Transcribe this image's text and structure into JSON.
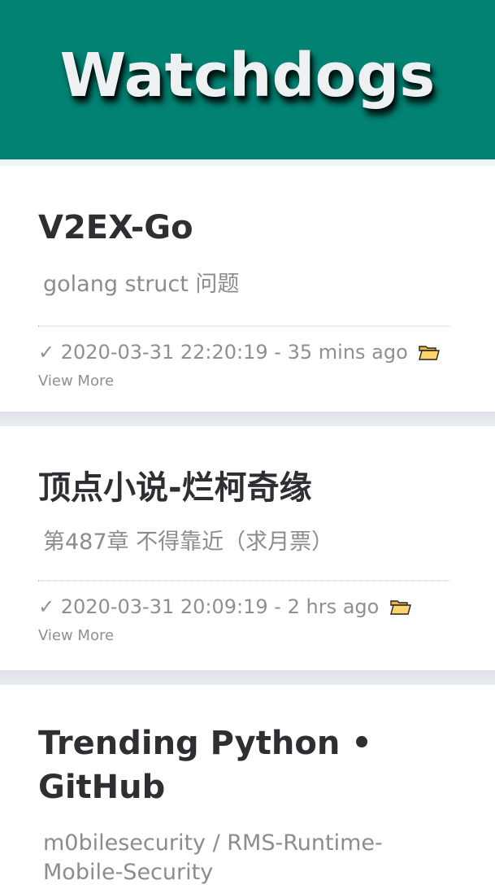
{
  "header": {
    "title": "Watchdogs"
  },
  "colors": {
    "header_bg": "#028272",
    "title_text": "#2e2f33",
    "muted_text": "#8c8c8c"
  },
  "cards": [
    {
      "title": "V2EX-Go",
      "description": "golang struct 问题",
      "check": "✓",
      "timestamp": "2020-03-31 22:20:19",
      "separator": "-",
      "relative": "35 mins ago",
      "folder_icon": "folder-icon",
      "link": "View More"
    },
    {
      "title": "顶点小说-烂柯奇缘",
      "description": "第487章 不得靠近（求月票）",
      "check": "✓",
      "timestamp": "2020-03-31 20:09:19",
      "separator": "-",
      "relative": "2 hrs ago",
      "folder_icon": "folder-icon",
      "link": "View More"
    },
    {
      "title": "Trending Python • GitHub",
      "description": "m0bilesecurity / RMS-Runtime-Mobile-Security"
    }
  ]
}
